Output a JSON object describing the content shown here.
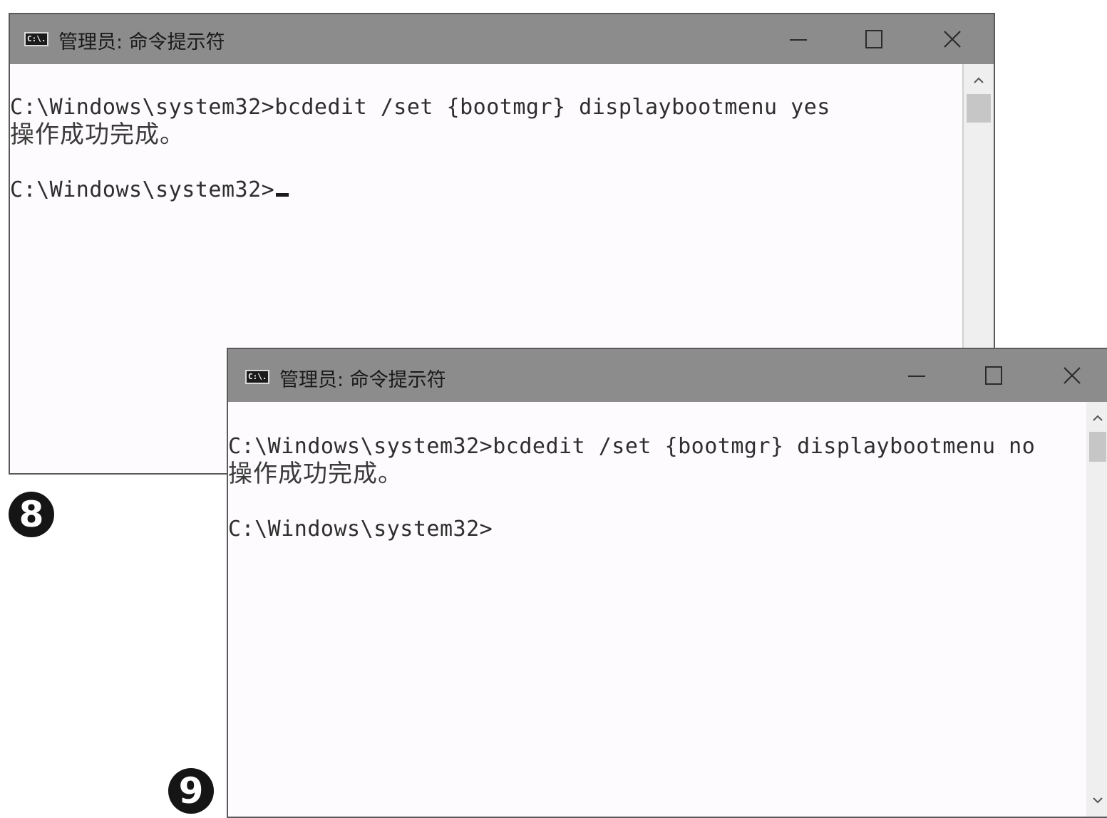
{
  "window1": {
    "title": "管理员: 命令提示符",
    "icon_label": "C:\\.",
    "icon": "cmd-icon",
    "console_lines": [
      "C:\\Windows\\system32>bcdedit /set {bootmgr} displaybootmenu yes",
      "操作成功完成。",
      "C:\\Windows\\system32>"
    ],
    "controls": [
      "minimize-icon",
      "maximize-icon",
      "close-icon"
    ]
  },
  "window2": {
    "title": "管理员: 命令提示符",
    "icon_label": "C:\\.",
    "icon": "cmd-icon",
    "console_lines": [
      "C:\\Windows\\system32>bcdedit /set {bootmgr} displaybootmenu no",
      "操作成功完成。",
      "C:\\Windows\\system32>"
    ],
    "controls": [
      "minimize-icon",
      "maximize-icon",
      "close-icon"
    ]
  },
  "step_badges": {
    "first": "8",
    "second": "9"
  },
  "colors": {
    "titlebar": "#8c8c8c",
    "console_background": "#fdfbfd",
    "console_text": "#2e2e2e",
    "badge": "#151515"
  }
}
